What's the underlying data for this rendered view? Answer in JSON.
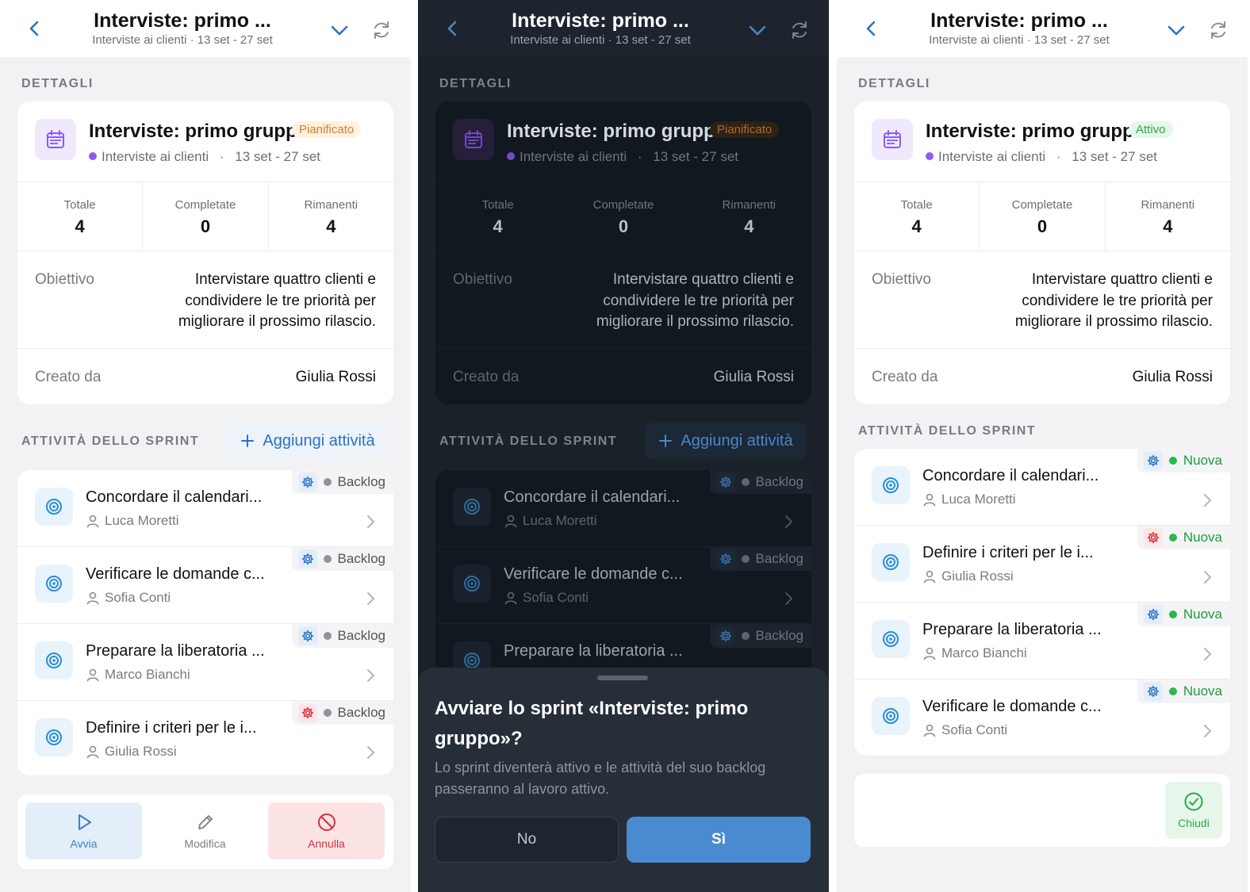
{
  "header": {
    "title": "Interviste: primo ...",
    "subtitle": "Interviste ai clienti · 13 set - 27 set"
  },
  "labels": {
    "details_section": "DETTAGLI",
    "tasks_section": "ATTIVITÀ DELLO SPRINT",
    "add_task": "Aggiungi attività",
    "total": "Totale",
    "completed": "Completate",
    "remaining": "Rimanenti",
    "goal": "Obiettivo",
    "created_by": "Creato da"
  },
  "sprint": {
    "name": "Interviste: primo gruppo",
    "project": "Interviste ai clienti",
    "separator": "·",
    "dates": "13 set - 27 set",
    "total": "4",
    "completed": "0",
    "remaining": "4",
    "goal": "Intervistare quattro clienti e condividere le tre priorità per migliorare il prossimo rilascio.",
    "creator": "Giulia Rossi",
    "status_planned": "Pianificato",
    "status_active": "Attivo"
  },
  "tasks_backlog": [
    {
      "name": "Concordare il calendari...",
      "assignee": "Luca Moretti",
      "status": "Backlog",
      "priority": "normal"
    },
    {
      "name": "Verificare le domande c...",
      "assignee": "Sofia Conti",
      "status": "Backlog",
      "priority": "normal"
    },
    {
      "name": "Preparare la liberatoria ...",
      "assignee": "Marco Bianchi",
      "status": "Backlog",
      "priority": "normal"
    },
    {
      "name": "Definire i criteri per le i...",
      "assignee": "Giulia Rossi",
      "status": "Backlog",
      "priority": "high"
    }
  ],
  "tasks_active": [
    {
      "name": "Concordare il calendari...",
      "assignee": "Luca Moretti",
      "status": "Nuova",
      "priority": "normal"
    },
    {
      "name": "Definire i criteri per le i...",
      "assignee": "Giulia Rossi",
      "status": "Nuova",
      "priority": "high"
    },
    {
      "name": "Preparare la liberatoria ...",
      "assignee": "Marco Bianchi",
      "status": "Nuova",
      "priority": "normal"
    },
    {
      "name": "Verificare le domande c...",
      "assignee": "Sofia Conti",
      "status": "Nuova",
      "priority": "normal"
    }
  ],
  "actions": {
    "start": "Avvia",
    "edit": "Modifica",
    "cancel": "Annulla",
    "close": "Chiudi"
  },
  "dialog": {
    "title": "Avviare lo sprint «Interviste: primo gruppo»?",
    "body": "Lo sprint diventerà attivo e le attività del suo backlog passeranno al lavoro attivo.",
    "no": "No",
    "yes": "Sì"
  },
  "colors": {
    "accent_blue": "#2a73c4",
    "planned_orange": "#d9821e",
    "active_green": "#2da84a",
    "danger_red": "#d7303b",
    "project_dot_purple": "#8a5cf6",
    "dark_background": "#1b2129"
  },
  "icons": [
    "back-arrow-icon",
    "chevron-down-icon",
    "sync-icon",
    "calendar-icon",
    "target-icon",
    "user-icon",
    "gear-icon",
    "chevron-right-icon",
    "plus-icon",
    "play-icon",
    "pencil-icon",
    "cancel-icon",
    "check-circle-icon"
  ]
}
